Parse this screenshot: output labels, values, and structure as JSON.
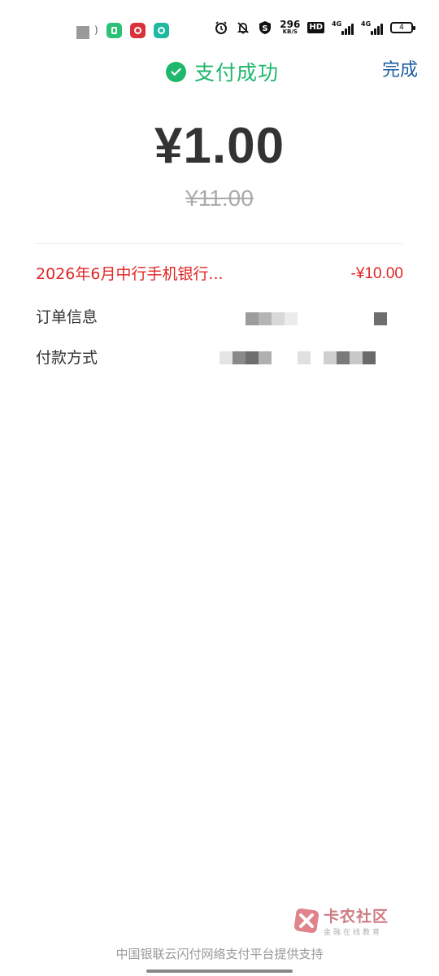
{
  "status_bar": {
    "net_speed_value": "296",
    "net_speed_unit": "KB/S",
    "hd_label": "HD",
    "signal_1_label": "4G",
    "signal_2_label": "4G",
    "battery_level": "4"
  },
  "header": {
    "status_text": "支付成功",
    "done_label": "完成"
  },
  "payment": {
    "amount": "¥1.00",
    "original_amount": "¥11.00"
  },
  "discount": {
    "label": "2026年6月中行手机银行...",
    "value": "-¥10.00"
  },
  "order_info": {
    "label": "订单信息"
  },
  "payment_method": {
    "label": "付款方式"
  },
  "watermark": {
    "title": "卡农社区",
    "subtitle": "金融在线教育"
  },
  "footer": {
    "text": "中国银联云闪付网络支付平台提供支持"
  },
  "colors": {
    "success": "#1fb76b",
    "link": "#1d5fa3",
    "discount": "#e02525",
    "amount": "#333333",
    "muted": "#aaaaaa"
  }
}
